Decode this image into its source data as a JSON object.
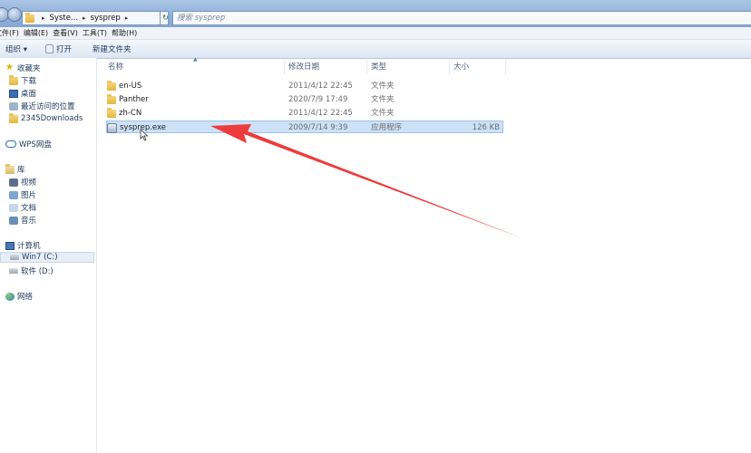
{
  "address": {
    "segments": [
      "Syste...",
      "sysprep"
    ],
    "search_placeholder": "搜索 sysprep"
  },
  "menu": [
    "文件(F)",
    "编辑(E)",
    "查看(V)",
    "工具(T)",
    "帮助(H)"
  ],
  "toolbar": {
    "organize": "组织 ▾",
    "open": "打开",
    "new_folder": "新建文件夹"
  },
  "sidebar": {
    "favorites": "收藏夹",
    "downloads": "下载",
    "desktop": "桌面",
    "recent": "最近访问的位置",
    "downloads2345": "2345Downloads",
    "wps": "WPS网盘",
    "library": "库",
    "videos": "视频",
    "pictures": "图片",
    "documents": "文档",
    "music": "音乐",
    "computer": "计算机",
    "drive_c": "Win7 (C:)",
    "drive_d": "软件 (D:)",
    "network": "网络"
  },
  "columns": {
    "name": "名称",
    "date": "修改日期",
    "type": "类型",
    "size": "大小"
  },
  "files": [
    {
      "name": "en-US",
      "date": "2011/4/12 22:45",
      "type": "文件夹",
      "size": ""
    },
    {
      "name": "Panther",
      "date": "2020/7/9 17:49",
      "type": "文件夹",
      "size": ""
    },
    {
      "name": "zh-CN",
      "date": "2011/4/12 22:45",
      "type": "文件夹",
      "size": ""
    },
    {
      "name": "sysprep.exe",
      "date": "2009/7/14 9:39",
      "type": "应用程序",
      "size": "126 KB"
    }
  ],
  "colors": {
    "annotation_arrow": "#ee3b3b",
    "selection": "#cde1f7"
  }
}
